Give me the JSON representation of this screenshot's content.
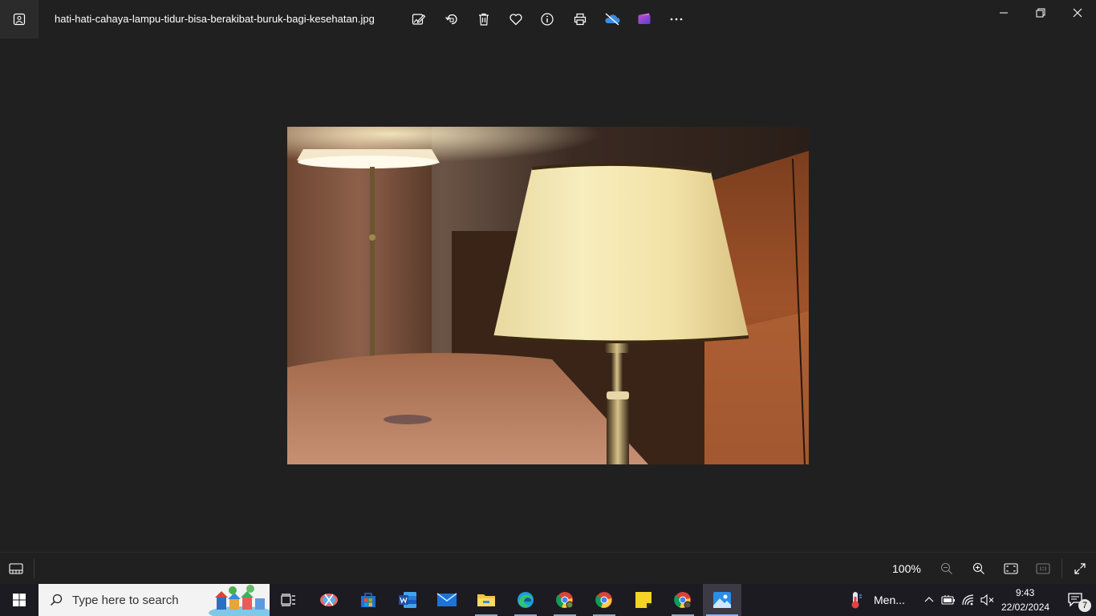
{
  "window": {
    "filename": "hati-hati-cahaya-lampu-tidur-bisa-berakibat-buruk-bagi-kesehatan.jpg",
    "toolbar": [
      "edit-image-icon",
      "rotate-icon",
      "delete-icon",
      "favorite-icon",
      "info-icon",
      "print-icon",
      "onedrive-off-icon",
      "clipchamp-icon",
      "more-icon"
    ],
    "controls": [
      "minimize-icon",
      "restore-icon",
      "close-icon"
    ]
  },
  "bottom_bar": {
    "zoom": "100%",
    "icons": [
      "filmstrip-icon",
      "zoom-out-icon",
      "zoom-in-icon",
      "fit-window-icon",
      "actual-size-icon",
      "fullscreen-icon"
    ]
  },
  "taskbar": {
    "search_placeholder": "Type here to search",
    "apps": [
      "start-icon",
      "task-view-icon",
      "snipping-tool-icon",
      "store-icon",
      "word-icon",
      "mail-icon",
      "file-explorer-icon",
      "edge-icon",
      "chrome-icon",
      "chrome-icon",
      "sticky-notes-icon",
      "chrome-icon",
      "photos-icon"
    ],
    "weather_text": "Men...",
    "time": "9:43",
    "date": "22/02/2024",
    "notification_count": "7"
  },
  "colors": {
    "background": "#202020",
    "taskbar": "#1c1b22",
    "accent": "#8fb4ff"
  }
}
